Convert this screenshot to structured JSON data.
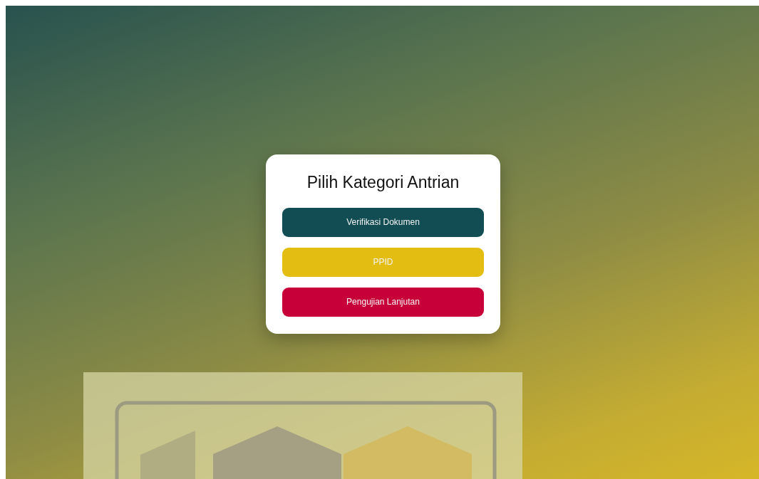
{
  "dialog": {
    "title": "Pilih Kategori Antrian",
    "categories": [
      {
        "label": "Verifikasi Dokumen",
        "color": "#114d52"
      },
      {
        "label": "PPID",
        "color": "#e3bd12"
      },
      {
        "label": "Pengujian Lanjutan",
        "color": "#c8003a"
      }
    ]
  }
}
